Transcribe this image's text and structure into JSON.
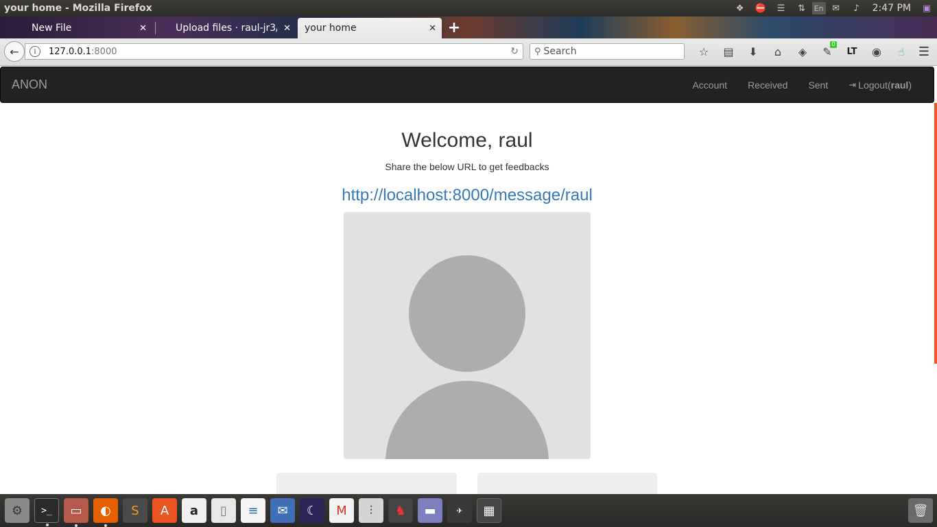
{
  "system": {
    "window_title": "your home - Mozilla Firefox",
    "keyboard_layout": "En",
    "clock": "2:47 PM",
    "tray_icons": [
      "dropbox-icon",
      "no-entry-icon",
      "list-icon",
      "network-icon",
      "keyboard-layout",
      "mail-icon",
      "volume-icon",
      "clock",
      "session-icon"
    ]
  },
  "browser": {
    "tabs": [
      {
        "label": "New File",
        "active": false
      },
      {
        "label": "Upload files · raul-jr3/",
        "active": false
      },
      {
        "label": "your home",
        "active": true
      }
    ],
    "new_tab": "+",
    "url_host": "127.0.0.1",
    "url_port": ":8000",
    "search_placeholder": "Search",
    "toolbar_icons": [
      "bookmark-star-icon",
      "reading-list-icon",
      "download-icon",
      "home-icon",
      "pocket-icon",
      "extension-icon",
      "languagetool-icon",
      "color-picker-icon",
      "extension-touch-icon",
      "menu-icon"
    ],
    "extension_badge": "0",
    "lt_label": "LT"
  },
  "site": {
    "brand": "ANON",
    "nav": {
      "account": "Account",
      "received": "Received",
      "sent": "Sent",
      "logout_prefix": "Logout(",
      "logout_user": "raul",
      "logout_suffix": ")"
    },
    "welcome": "Welcome, raul",
    "subtitle": "Share the below URL to get feedbacks",
    "share_url": "http://localhost:8000/message/raul"
  },
  "dock": {
    "items": [
      "settings-icon",
      "terminal-icon",
      "files-icon",
      "firefox-icon",
      "sublime-icon",
      "software-center-icon",
      "amazon-icon",
      "document-icon",
      "writer-icon",
      "thunderbird-icon",
      "stellarium-icon",
      "gmail-icon",
      "mixer-icon",
      "game-icon",
      "emulator-icon",
      "ceeux-icon",
      "workspace-icon",
      "trash-icon"
    ]
  },
  "colors": {
    "navbar_bg": "#222222",
    "link": "#337ab7",
    "avatar_bg": "#e1e1e1",
    "avatar_fg": "#adadad",
    "scrollbar": "#e55b24"
  }
}
